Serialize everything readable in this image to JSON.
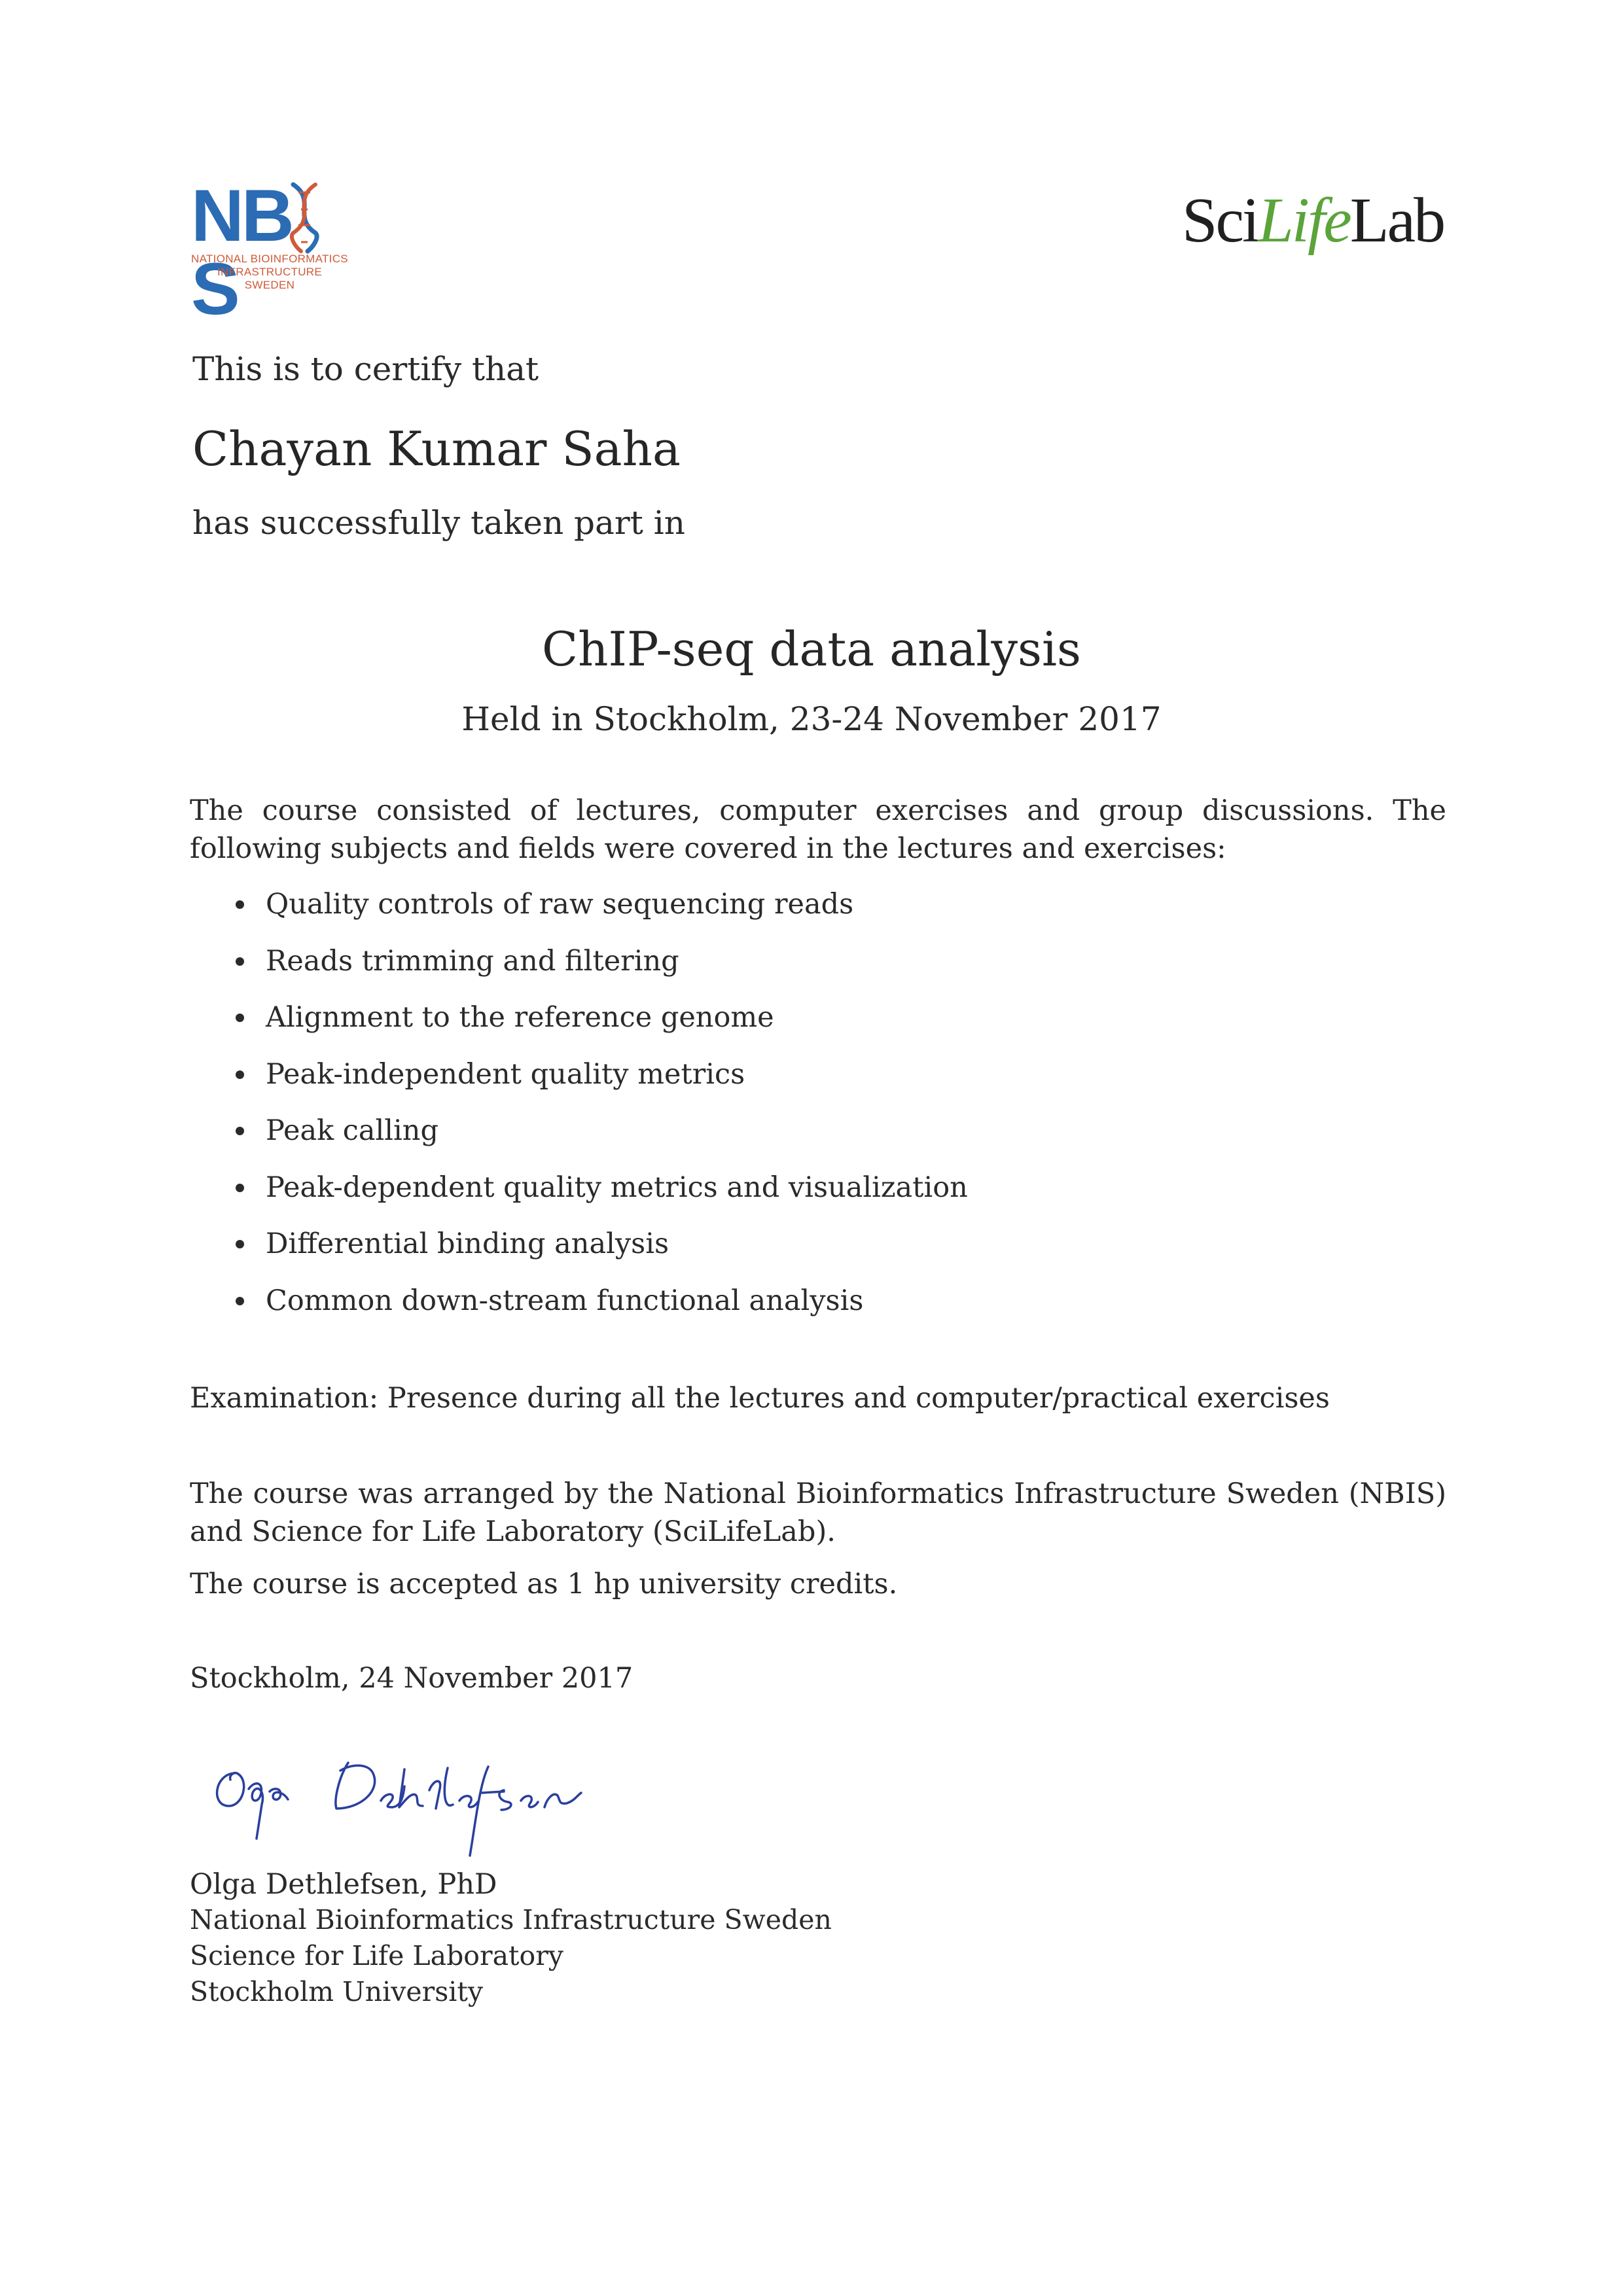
{
  "logos": {
    "nbis": {
      "wordmark_prefix": "NB",
      "wordmark_mid": "S",
      "wordmark_suffix": "S",
      "subtitle_line1": "NATIONAL BIOINFORMATICS",
      "subtitle_line2": "INFRASTRUCTURE SWEDEN",
      "color_primary": "#2b6cb4",
      "color_secondary": "#d05a3a"
    },
    "scilifelab": {
      "part1": "Sci",
      "part2": "Life",
      "part3": "Lab",
      "color_accent": "#5aa43a"
    }
  },
  "certificate": {
    "intro": "This is to certify that",
    "recipient": "Chayan Kumar Saha",
    "participation": "has successfully taken part in",
    "course_title": "ChIP-seq data analysis",
    "location": "Held in Stockholm, 23-24 November 2017",
    "description": "The course consisted of lectures, computer exercises and group discussions.  The following subjects and fields were covered in the lectures and exercises:",
    "topics": [
      "Quality controls of raw sequencing reads",
      "Reads trimming and filtering",
      "Alignment to the reference genome",
      "Peak-independent quality metrics",
      "Peak calling",
      "Peak-dependent quality metrics and visualization",
      "Differential binding analysis",
      "Common down-stream functional analysis"
    ],
    "examination": "Examination: Presence during all the lectures and computer/practical exercises",
    "arrangement": "The course was arranged by the National Bioinformatics Infrastructure Sweden (NBIS) and Science for Life Laboratory (SciLifeLab).",
    "credits": "The course is accepted as 1 hp university credits.",
    "place_date": "Stockholm, 24 November 2017"
  },
  "signer": {
    "signature": "Olga Dethlefsen",
    "name": "Olga Dethlefsen, PhD",
    "affiliation_1": "National Bioinformatics Infrastructure Sweden",
    "affiliation_2": "Science for Life Laboratory",
    "affiliation_3": "Stockholm University",
    "ink_color": "#2a3f9e"
  }
}
